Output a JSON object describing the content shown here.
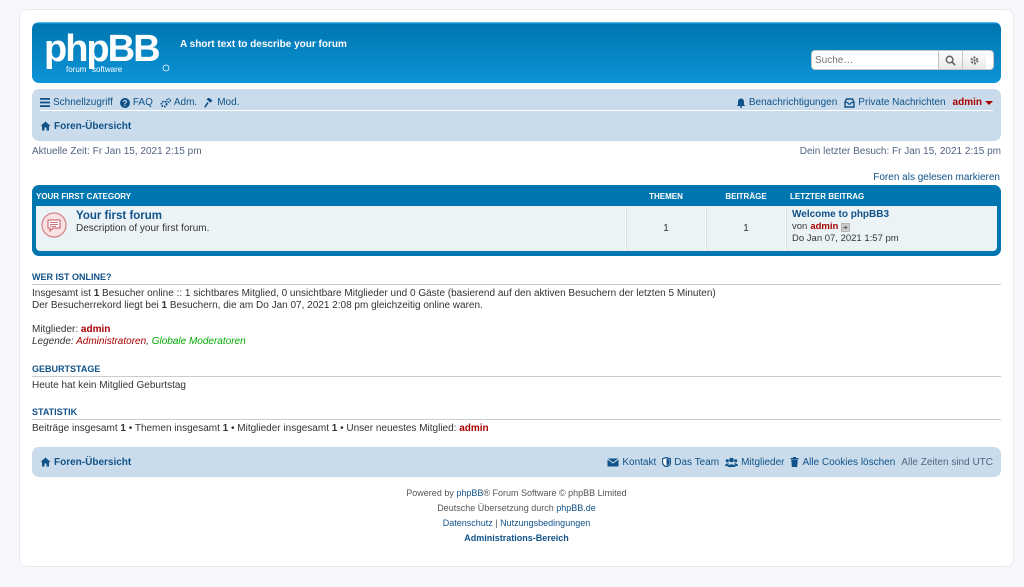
{
  "header": {
    "logo_text": "phpBB",
    "logo_sub": "forum software",
    "tagline": "A short text to describe your forum",
    "search_placeholder": "Suche…"
  },
  "nav": {
    "quicklinks": "Schnellzugriff",
    "faq": "FAQ",
    "adm": "Adm.",
    "mod": "Mod.",
    "notifications": "Benachrichtigungen",
    "pm": "Private Nachrichten",
    "user": "admin",
    "breadcrumb": "Foren-Übersicht"
  },
  "times": {
    "current": "Aktuelle Zeit: Fr Jan 15, 2021 2:15 pm",
    "last_visit": "Dein letzter Besuch: Fr Jan 15, 2021 2:15 pm"
  },
  "mark_read": "Foren als gelesen markieren",
  "forum_table": {
    "category": "Your first category",
    "col_topics": "Themen",
    "col_posts": "Beiträge",
    "col_last": "Letzter Beitrag",
    "rows": [
      {
        "title": "Your first forum",
        "description": "Description of your first forum.",
        "topics": "1",
        "posts": "1",
        "last_title": "Welcome to phpBB3",
        "last_by_prefix": "von",
        "last_by": "admin",
        "last_date": "Do Jan 07, 2021 1:57 pm"
      }
    ]
  },
  "online": {
    "title": "Wer ist online?",
    "line1_a": "Insgesamt ist ",
    "line1_b": "1",
    "line1_c": " Besucher online :: 1 sichtbares Mitglied, 0 unsichtbare Mitglieder und 0 Gäste (basierend auf den aktiven Besuchern der letzten 5 Minuten)",
    "line2_a": "Der Besucherrekord liegt bei ",
    "line2_b": "1",
    "line2_c": " Besuchern, die am Do Jan 07, 2021 2:08 pm gleichzeitig online waren.",
    "members_label": "Mitglieder: ",
    "members": "admin",
    "legend_label": "Legende: ",
    "legend_admins": "Administratoren",
    "legend_sep": ", ",
    "legend_mods": "Globale Moderatoren"
  },
  "birthdays": {
    "title": "Geburtstage",
    "text": "Heute hat kein Mitglied Geburtstag"
  },
  "stats": {
    "title": "Statistik",
    "a": "Beiträge insgesamt ",
    "b": "1",
    "c": " • Themen insgesamt ",
    "d": "1",
    "e": " • Mitglieder insgesamt ",
    "f": "1",
    "g": " • Unser neuestes Mitglied: ",
    "h": "admin"
  },
  "footer_nav": {
    "index": "Foren-Übersicht",
    "contact": "Kontakt",
    "team": "Das Team",
    "members": "Mitglieder",
    "cookies": "Alle Cookies löschen",
    "timezone": "Alle Zeiten sind UTC"
  },
  "copyright": {
    "powered_a": "Powered by ",
    "powered_link": "phpBB",
    "powered_b": "® Forum Software © phpBB Limited",
    "translation_a": "Deutsche Übersetzung durch ",
    "translation_link": "phpBB.de",
    "privacy": "Datenschutz",
    "sep": " | ",
    "terms": "Nutzungsbedingungen",
    "acp": "Administrations-Bereich"
  },
  "colors": {
    "brand_blue": "#12a3eb",
    "link": "#105289",
    "admin_red": "#aa0000",
    "mod_green": "#00aa00"
  }
}
